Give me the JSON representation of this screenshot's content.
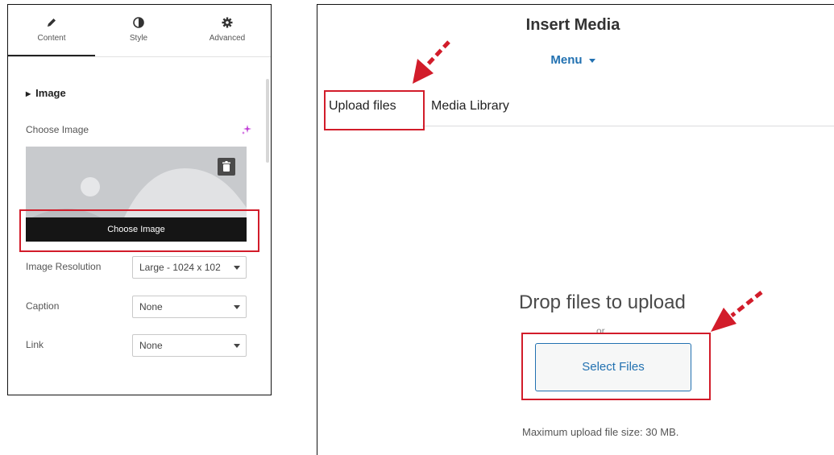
{
  "left_panel": {
    "tabs": [
      {
        "label": "Content",
        "icon": "pencil-icon"
      },
      {
        "label": "Style",
        "icon": "half-circle-icon"
      },
      {
        "label": "Advanced",
        "icon": "gear-icon"
      }
    ],
    "section_title": "Image",
    "choose_image_label": "Choose Image",
    "choose_image_button": "Choose Image",
    "image_resolution": {
      "label": "Image Resolution",
      "value": "Large - 1024 x 102"
    },
    "caption": {
      "label": "Caption",
      "value": "None"
    },
    "link": {
      "label": "Link",
      "value": "None"
    }
  },
  "right_panel": {
    "title": "Insert Media",
    "menu": "Menu",
    "tabs": [
      "Upload files",
      "Media Library"
    ],
    "drop_text": "Drop files to upload",
    "or_text": "or",
    "select_files": "Select Files",
    "max_upload": "Maximum upload file size: 30 MB."
  },
  "colors": {
    "annotation_red": "#d21c2a",
    "wp_blue": "#2271b1"
  }
}
